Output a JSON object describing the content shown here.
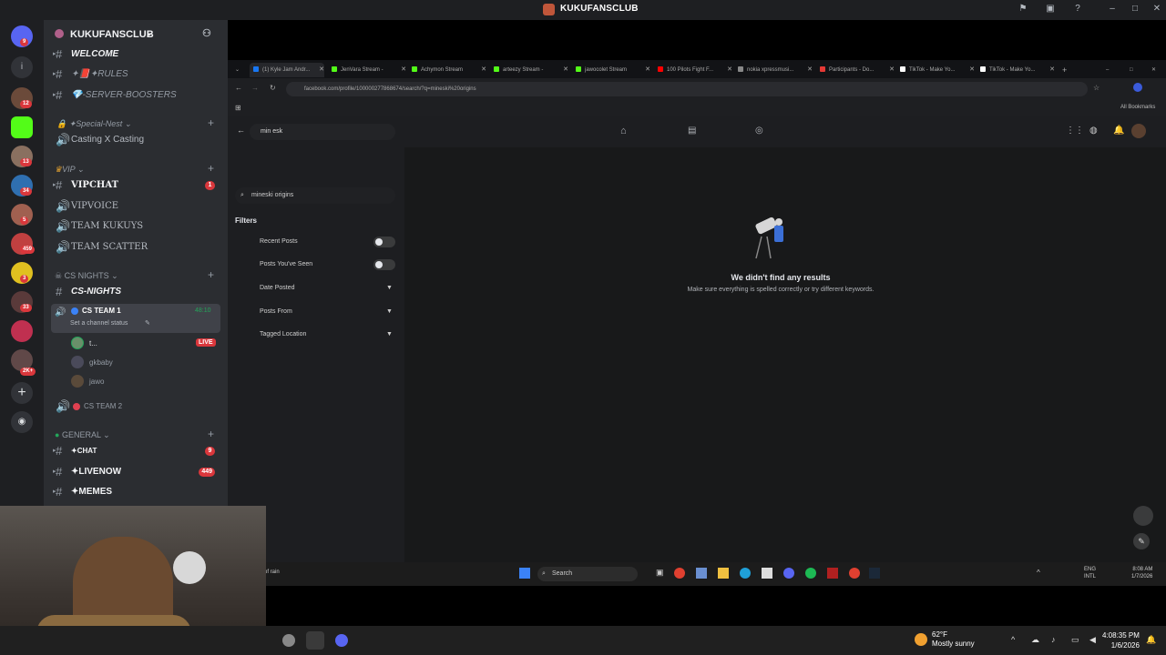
{
  "window": {
    "title": "KUKUFANSCLUB"
  },
  "server": {
    "name": "KUKUFANSCLUB"
  },
  "server_badges": [
    "9",
    "12",
    "13",
    "34",
    "5",
    "459",
    "3",
    "33",
    "2K+"
  ],
  "channels": {
    "welcome": "WELCOME",
    "rules": "✦📕✦RULES",
    "boosters": "💎-SERVER-BOOSTERS",
    "special_nest": "✦Special-Nest",
    "casting": "Casting X Casting",
    "vip_cat": "VIP",
    "vipchat": "VIPCHAT",
    "vipchat_badge": "1",
    "vipvoice": "VIPVOICE",
    "team_kukuys": "TEAM KUKUYS",
    "team_scatter": "TEAM SCATTER",
    "cs_nights_cat": "CS NIGHTS",
    "cs_nights": "CS-NIGHTS",
    "cs_team1": "CS TEAM 1",
    "cs_team1_time": "48:10",
    "cs_team1_status": "Set a channel status",
    "member1": "t...",
    "member1_badge": "LIVE",
    "member2": "gkbaby",
    "member3": "jawo",
    "cs_team2": "CS TEAM 2",
    "general_cat": "GENERAL",
    "chat": "✦CHAT",
    "chat_badge": "9",
    "livenow": "✦LIVENOW",
    "livenow_badge": "449",
    "memes": "✦MEMES"
  },
  "browser": {
    "tabs": [
      {
        "label": "(1) Kyle Jam Andr...",
        "color": "#1877f2"
      },
      {
        "label": "JenVara Stream -",
        "color": "#53fc18"
      },
      {
        "label": "Achymon Stream",
        "color": "#53fc18"
      },
      {
        "label": "arteezy Stream -",
        "color": "#53fc18"
      },
      {
        "label": "jawocolet Stream",
        "color": "#53fc18"
      },
      {
        "label": "100 Pilots Fight F...",
        "color": "#ff0000"
      },
      {
        "label": "nokia xpressmusi...",
        "color": "#888888"
      },
      {
        "label": "Participants - Do...",
        "color": "#e53935"
      },
      {
        "label": "TikTok - Make Yo...",
        "color": "#ffffff"
      },
      {
        "label": "TikTok - Make Yo...",
        "color": "#ffffff"
      }
    ],
    "url": "facebook.com/profile/100000277868674/search/?q=mineski%20origins",
    "bookmarks": "All Bookmarks"
  },
  "facebook": {
    "search_value": "min esk",
    "query_pill": "mineski origins",
    "filters_heading": "Filters",
    "filters": [
      "Recent Posts",
      "Posts You've Seen",
      "Date Posted",
      "Posts From",
      "Tagged Location"
    ],
    "no_results_title": "We didn't find any results",
    "no_results_sub": "Make sure everything is spelled correctly or try different keywords."
  },
  "inner_taskbar": {
    "search": "Search",
    "lang": "ENG",
    "lang2": "INTL",
    "time": "8:08 AM",
    "date": "1/7/2026",
    "weather_tail": "of rain"
  },
  "taskbar": {
    "temp": "62°F",
    "weather": "Mostly sunny",
    "time": "4:08:35 PM",
    "date": "1/6/2026"
  }
}
